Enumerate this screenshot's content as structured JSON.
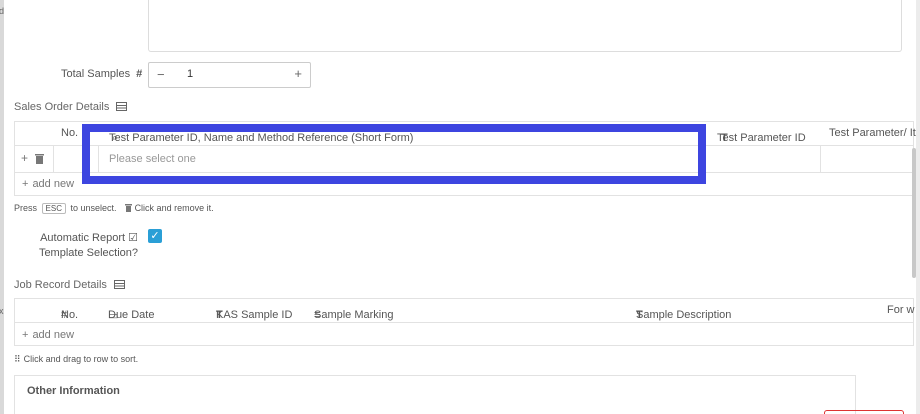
{
  "sidebar_fragments": [
    "d",
    "x"
  ],
  "total_samples": {
    "label": "Total Samples",
    "icon": "#",
    "minus": "−",
    "value": "1",
    "plus": "+"
  },
  "sales_order": {
    "title": "Sales Order Details",
    "columns": {
      "no": "No.",
      "test_param_ref": "Test Parameter ID, Name and Method Reference (Short Form)",
      "test_param_id": "Test Parameter ID",
      "test_param_item": "Test Parameter/ Ite"
    },
    "row": {
      "placeholder": "Please select one"
    },
    "add_new": "add new"
  },
  "hint1": {
    "press": "Press",
    "esc": "ESC",
    "unselect": "to unselect.",
    "remove": "Click and remove it."
  },
  "auto_report": {
    "label_line1": "Automatic Report",
    "label_line2": "Template Selection?",
    "check": "✓"
  },
  "job_record": {
    "title": "Job Record Details",
    "columns": {
      "no": "No.",
      "due_date": "Due Date",
      "kas_sample_id": "KAS Sample ID",
      "sample_marking": "Sample Marking",
      "sample_description": "Sample Description",
      "for_w": "For w"
    },
    "add_new": "add new"
  },
  "hint2": "Click and drag to row to sort.",
  "other_info": "Other Information",
  "colors": {
    "accent": "#2a9fd6",
    "highlight": "#3d45e0"
  }
}
